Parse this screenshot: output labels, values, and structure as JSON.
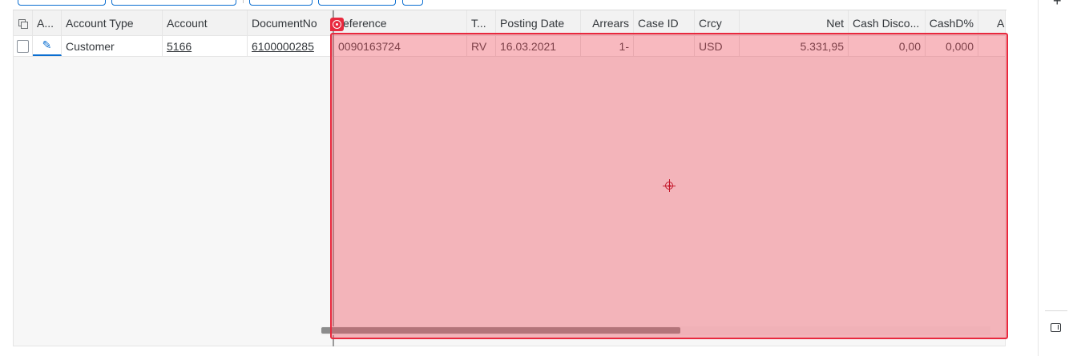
{
  "table": {
    "headers": {
      "copy": "",
      "a": "A...",
      "account_type": "Account Type",
      "account": "Account",
      "document_no": "DocumentNo",
      "reference": "eference",
      "t": "T...",
      "posting_date": "Posting Date",
      "arrears": "Arrears",
      "case_id": "Case ID",
      "crcy": "Crcy",
      "net": "Net",
      "cash_discount": "Cash Disco...",
      "cash_pct": "CashD%",
      "ar": "Ar"
    },
    "rows": [
      {
        "account_type": "Customer",
        "account": "5166",
        "document_no": "6100000285",
        "reference": "0090163724",
        "t": "RV",
        "posting_date": "16.03.2021",
        "arrears": "1-",
        "case_id": "",
        "crcy": "USD",
        "net": "5.331,95",
        "cash_discount": "0,00",
        "cash_pct": "0,000"
      }
    ]
  },
  "side_panel": {
    "add_icon": "plus-icon",
    "toggle_icon": "side-panel-toggle-icon"
  },
  "colors": {
    "accent": "#0a6ed1",
    "highlight": "#e8293e",
    "header_bg": "#f2f2f2"
  }
}
